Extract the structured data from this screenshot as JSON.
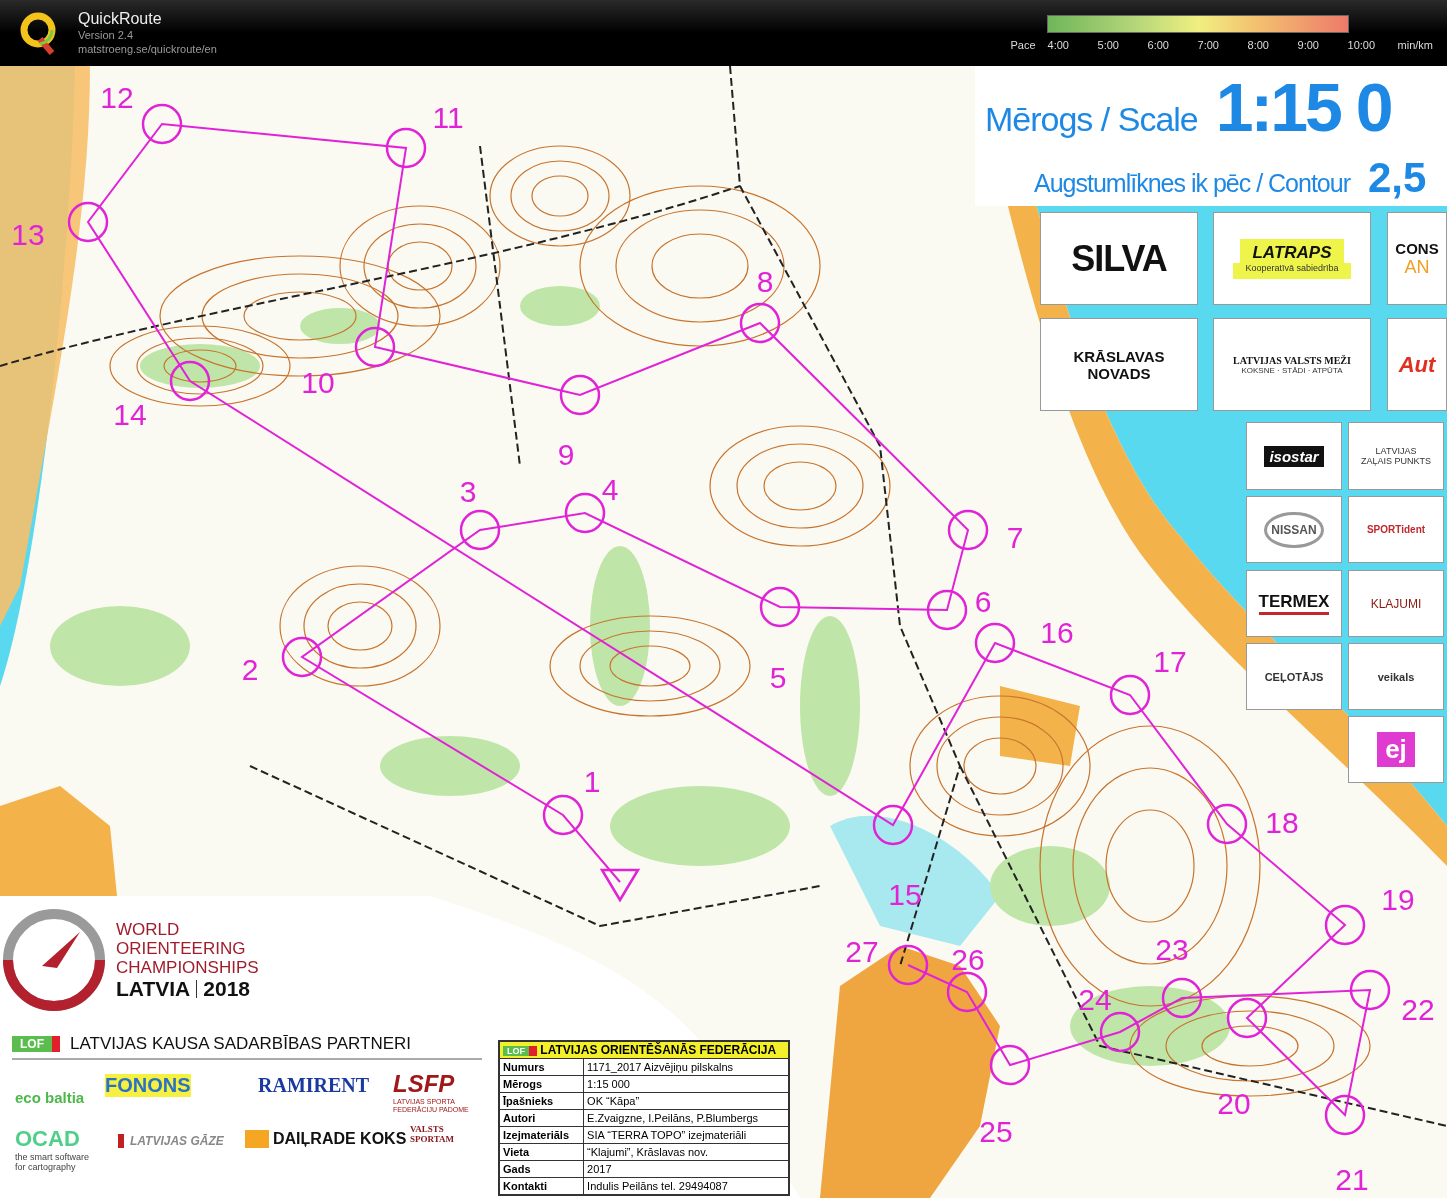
{
  "app": {
    "title": "QuickRoute",
    "version": "Version 2.4",
    "url": "matstroeng.se/quickroute/en"
  },
  "pace_scale": {
    "label": "Pace",
    "ticks": [
      "4:00",
      "5:00",
      "6:00",
      "7:00",
      "8:00",
      "9:00",
      "10:00"
    ],
    "unit": "min/km"
  },
  "map": {
    "scale_label": "Mērogs / Scale",
    "scale_value": "1:15 0",
    "contour_label": "Augstumlīknes ik pēc / Contour",
    "contour_value": "2,5",
    "controls": [
      {
        "number": "1"
      },
      {
        "number": "2"
      },
      {
        "number": "3"
      },
      {
        "number": "4"
      },
      {
        "number": "5"
      },
      {
        "number": "6"
      },
      {
        "number": "7"
      },
      {
        "number": "8"
      },
      {
        "number": "9"
      },
      {
        "number": "10"
      },
      {
        "number": "11"
      },
      {
        "number": "12"
      },
      {
        "number": "13"
      },
      {
        "number": "14"
      },
      {
        "number": "15"
      },
      {
        "number": "16"
      },
      {
        "number": "17"
      },
      {
        "number": "18"
      },
      {
        "number": "19"
      },
      {
        "number": "20"
      },
      {
        "number": "21"
      },
      {
        "number": "22"
      },
      {
        "number": "23"
      },
      {
        "number": "24"
      },
      {
        "number": "25"
      },
      {
        "number": "26"
      },
      {
        "number": "27"
      }
    ],
    "sponsors": [
      {
        "lines": [
          "SILVA"
        ]
      },
      {
        "lines": [
          "LATRAPS",
          "Kooperatīvā sabiedrība"
        ]
      },
      {
        "lines": [
          "CONS",
          "AN"
        ]
      },
      {
        "lines": [
          "KRĀSLAVAS",
          "NOVADS"
        ]
      },
      {
        "lines": [
          "LATVIJAS VALSTS MEŽI",
          "KOKSNE · STĀDI · ATPŪTA"
        ]
      },
      {
        "lines": [
          "Aut"
        ]
      },
      {
        "lines": [
          "isostar"
        ]
      },
      {
        "lines": [
          "LATVIJAS",
          "ZAĻAIS PUNKTS"
        ]
      },
      {
        "lines": [
          "NISSAN"
        ]
      },
      {
        "lines": [
          "SPORTident"
        ]
      },
      {
        "lines": [
          "TERMEX"
        ]
      },
      {
        "lines": [
          "KLAJUMI"
        ]
      },
      {
        "lines": [
          "CEĻOTĀJS"
        ]
      },
      {
        "lines": [
          "veikals"
        ]
      },
      {
        "lines": [
          "ej"
        ]
      }
    ]
  },
  "event_logo": {
    "lines": [
      "WORLD",
      "ORIENTEERING",
      "CHAMPIONSHIPS"
    ],
    "country": "LATVIA",
    "year": "2018"
  },
  "partners": {
    "badge": "LOF",
    "title": "LATVIJAS KAUSA SADARBĪBAS PARTNERI",
    "logos": [
      {
        "lines": [
          "eco baltia"
        ]
      },
      {
        "lines": [
          "FONONS"
        ]
      },
      {
        "lines": [
          "RAMIRENT"
        ]
      },
      {
        "lines": [
          "LSFP",
          "LATVIJAS SPORTA FEDERĀCIJU PADOME"
        ]
      },
      {
        "lines": [
          "OCAD",
          "the smart software",
          "for cartography"
        ]
      },
      {
        "lines": [
          "LATVIJAS GĀZE"
        ]
      },
      {
        "lines": [
          "DAIĻRADE KOKS"
        ]
      },
      {
        "lines": [
          "VALSTS",
          "SPORTAM"
        ]
      }
    ]
  },
  "info_table": {
    "badge": "LOF",
    "title": "LATVIJAS ORIENTĒŠANĀS FEDERĀCIJA",
    "rows": [
      [
        "Numurs",
        "1171_2017 Aizvējiņu pilskalns"
      ],
      [
        "Mērogs",
        "1:15 000"
      ],
      [
        "Īpašnieks",
        "OK “Kāpa”"
      ],
      [
        "Autori",
        "E.Zvaigzne, I.Peilāns, P.Blumbergs"
      ],
      [
        "Izejmateriāls",
        "SIA “TERRA TOPO” izejmateriāli"
      ],
      [
        "Vieta",
        "“Klajumi”, Krāslavas nov."
      ],
      [
        "Gads",
        "2017"
      ],
      [
        "Kontakti",
        "Indulis Peilāns tel. 29494087"
      ]
    ]
  }
}
